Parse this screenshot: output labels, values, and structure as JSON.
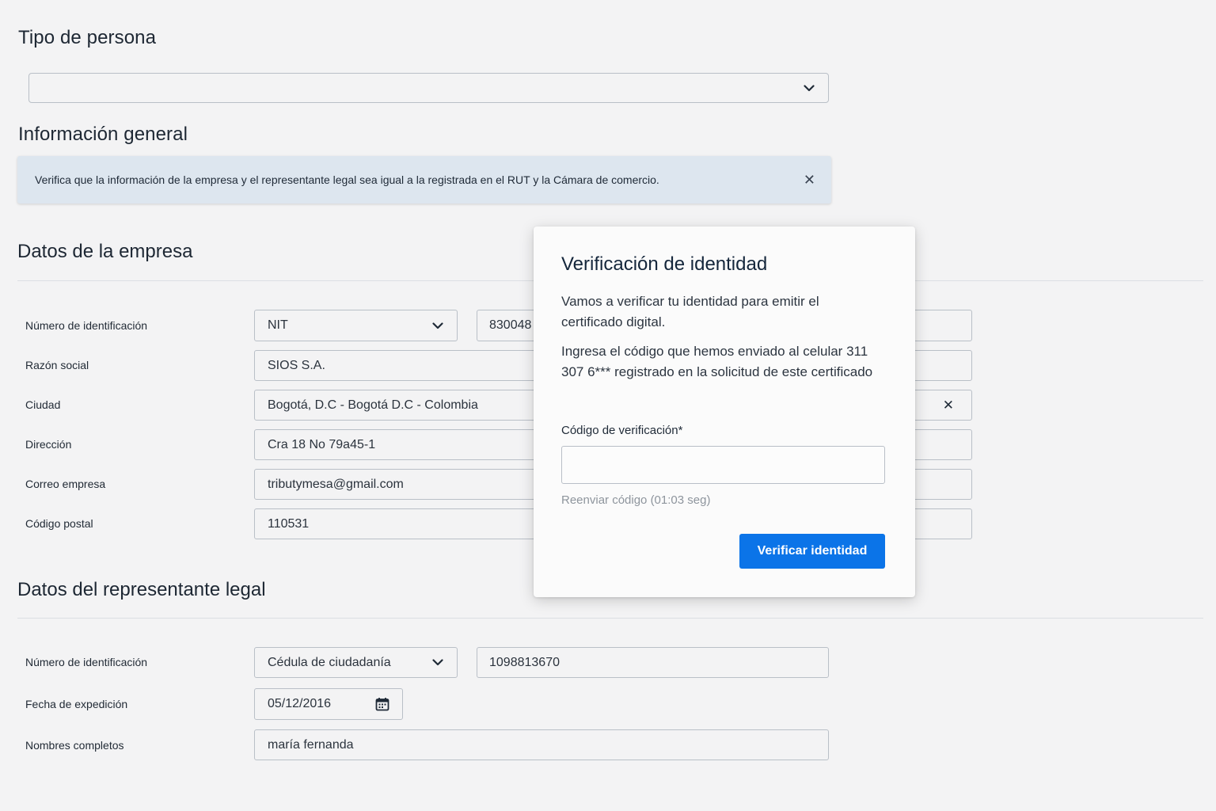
{
  "tipo_persona": {
    "title": "Tipo de persona",
    "select_value": ""
  },
  "info_general": {
    "title": "Información general",
    "alert_text": "Verifica que la información de la empresa y el representante legal sea igual a la registrada en el RUT y la Cámara de comercio.",
    "close_symbol": "✕"
  },
  "empresa": {
    "title": "Datos de la empresa",
    "id_label": "Número de identificación",
    "id_type": "NIT",
    "id_number": "830048",
    "razon_label": "Razón social",
    "razon_value": "SIOS S.A.",
    "ciudad_label": "Ciudad",
    "ciudad_value": "Bogotá, D.C - Bogotá D.C - Colombia",
    "ciudad_clear": "✕",
    "direccion_label": "Dirección",
    "direccion_value": "Cra 18 No 79a45-1",
    "correo_label": "Correo empresa",
    "correo_value": "tributymesa@gmail.com",
    "postal_label": "Código postal",
    "postal_value": "110531"
  },
  "representante": {
    "title": "Datos del representante legal",
    "id_label": "Número de identificación",
    "id_type": "Cédula de ciudadanía",
    "id_number": "1098813670",
    "fecha_label": "Fecha de expedición",
    "fecha_value": "05/12/2016",
    "nombres_label": "Nombres completos",
    "nombres_value": "maría fernanda"
  },
  "modal": {
    "title": "Verificación de identidad",
    "paragraph1": "Vamos a verificar tu identidad para emitir el certificado digital.",
    "paragraph2": "Ingresa el código que hemos enviado al celular 311 307 6*** registrado en la solicitud de este certificado",
    "code_label": "Código de verificación*",
    "code_value": "",
    "resend_text": "Reenviar código (01:03 seg)",
    "button_label": "Verificar identidad",
    "button_color": "#0b74e8"
  }
}
